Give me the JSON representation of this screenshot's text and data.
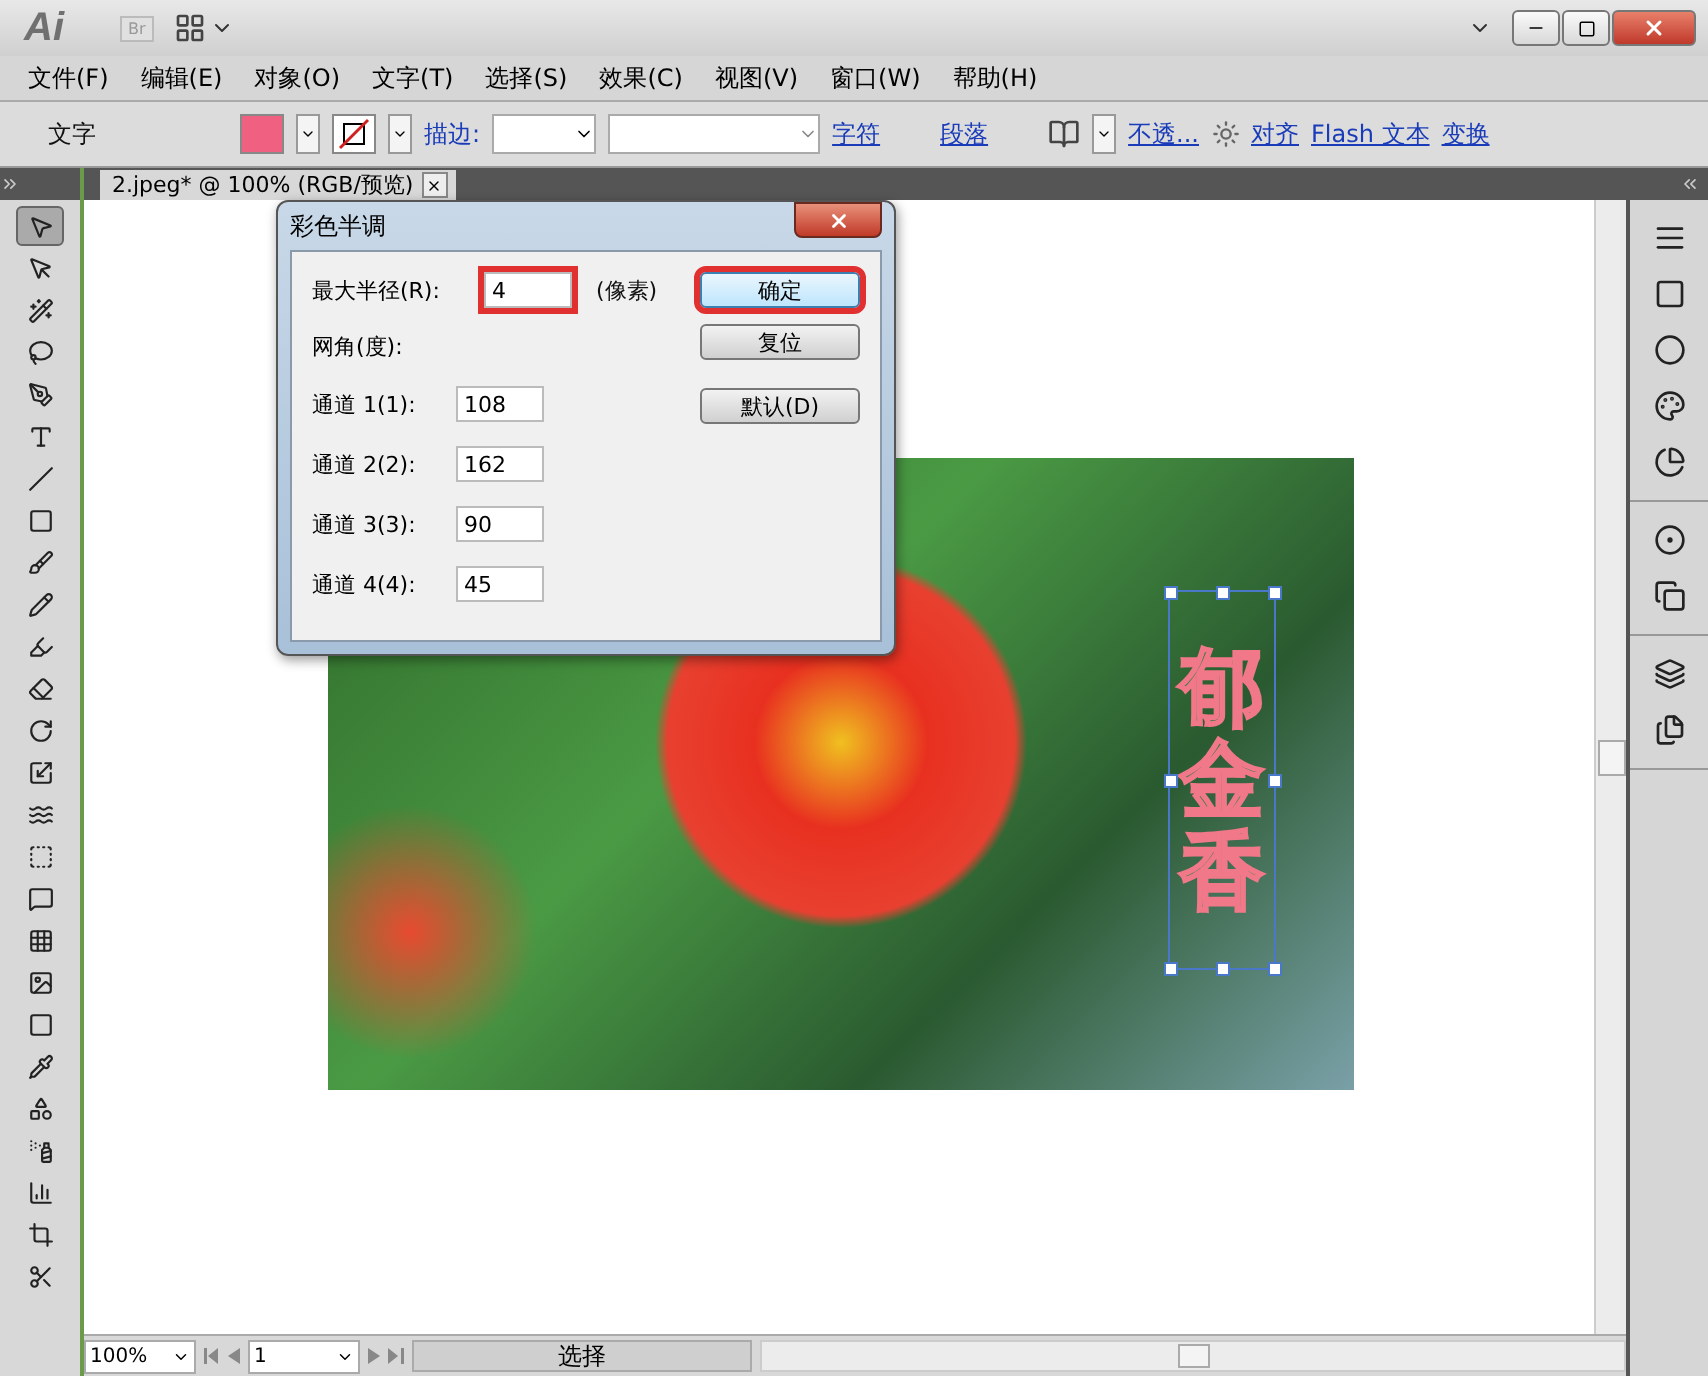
{
  "app_bar": {
    "logo": "Ai",
    "bridge_button": "Br"
  },
  "menu": [
    "文件(F)",
    "编辑(E)",
    "对象(O)",
    "文字(T)",
    "选择(S)",
    "效果(C)",
    "视图(V)",
    "窗口(W)",
    "帮助(H)"
  ],
  "control_bar": {
    "label": "文字",
    "stroke_label": "描边:",
    "panel_links": [
      "字符",
      "段落"
    ],
    "opacity_link": "不透...",
    "align_link": "对齐",
    "flash_link": "Flash 文本",
    "transform_link": "变换"
  },
  "document_tab": {
    "title": "2.jpeg* @ 100% (RGB/预览)"
  },
  "toolbox": [
    {
      "kind": "select",
      "selected": true
    },
    {
      "kind": "direct",
      "selected": false
    },
    {
      "kind": "wand",
      "selected": false
    },
    {
      "kind": "lasso",
      "selected": false
    },
    {
      "kind": "pen",
      "selected": false
    },
    {
      "kind": "type",
      "selected": false
    },
    {
      "kind": "line",
      "selected": false
    },
    {
      "kind": "rect",
      "selected": false
    },
    {
      "kind": "brush",
      "selected": false
    },
    {
      "kind": "pencil",
      "selected": false
    },
    {
      "kind": "blob",
      "selected": false
    },
    {
      "kind": "eraser",
      "selected": false
    },
    {
      "kind": "rotate",
      "selected": false
    },
    {
      "kind": "scale",
      "selected": false
    },
    {
      "kind": "warp",
      "selected": false
    },
    {
      "kind": "transform",
      "selected": false
    },
    {
      "kind": "shape",
      "selected": false
    },
    {
      "kind": "grid",
      "selected": false
    },
    {
      "kind": "mesh",
      "selected": false
    },
    {
      "kind": "gradient",
      "selected": false
    },
    {
      "kind": "eyedropper",
      "selected": false
    },
    {
      "kind": "blend",
      "selected": false
    },
    {
      "kind": "spray",
      "selected": false
    },
    {
      "kind": "graph",
      "selected": false
    },
    {
      "kind": "artboard",
      "selected": false
    },
    {
      "kind": "slice",
      "selected": false
    }
  ],
  "canvas": {
    "vertical_text": "郁金香"
  },
  "dialog": {
    "title": "彩色半调",
    "radius": {
      "label": "最大半径(R):",
      "value": "4",
      "unit": "(像素)",
      "highlighted": true
    },
    "angle_label": "网角(度):",
    "channels": [
      {
        "label": "通道 1(1):",
        "value": "108"
      },
      {
        "label": "通道 2(2):",
        "value": "162"
      },
      {
        "label": "通道 3(3):",
        "value": "90"
      },
      {
        "label": "通道 4(4):",
        "value": "45"
      }
    ],
    "buttons": [
      {
        "label": "确定",
        "highlighted": true,
        "default": true
      },
      {
        "label": "复位",
        "highlighted": false,
        "default": false
      },
      {
        "label": "默认(D)",
        "highlighted": false,
        "default": false
      }
    ]
  },
  "dock": [
    {
      "kind": "stroke"
    },
    {
      "kind": "gradient"
    },
    {
      "kind": "transparency"
    },
    {
      "kind": "swatches"
    },
    {
      "kind": "styles"
    },
    {
      "kind": "appearance"
    },
    {
      "kind": "arrange"
    },
    {
      "kind": "layers"
    },
    {
      "kind": "artboards"
    }
  ],
  "status_bar": {
    "zoom": "100%",
    "page": "1",
    "status": "选择"
  }
}
